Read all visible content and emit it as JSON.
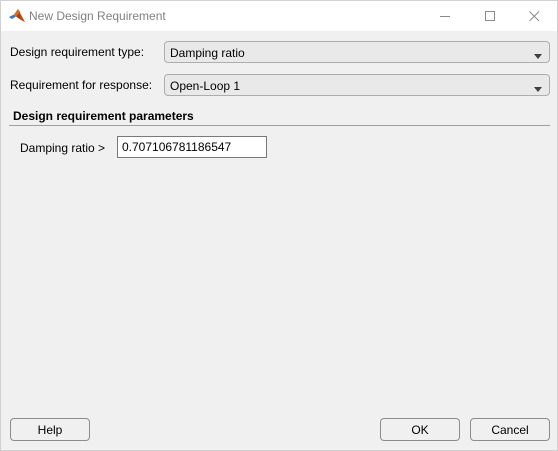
{
  "window": {
    "title": "New Design Requirement",
    "app_icon": "matlab-logo-icon"
  },
  "titlebar_buttons": {
    "minimize_icon": "minimize-icon",
    "maximize_icon": "maximize-icon",
    "close_icon": "close-icon"
  },
  "form": {
    "requirement_type": {
      "label": "Design requirement type:",
      "selected": "Damping ratio",
      "icon": "chevron-down-icon"
    },
    "requirement_response": {
      "label": "Requirement for response:",
      "selected": "Open-Loop 1",
      "icon": "chevron-down-icon"
    }
  },
  "parameters": {
    "section_title": "Design requirement parameters",
    "damping_label": "Damping ratio >",
    "damping_value": "0.707106781186547"
  },
  "footer": {
    "help_label": "Help",
    "ok_label": "OK",
    "cancel_label": "Cancel"
  },
  "colors": {
    "window_bg": "#f0f0f0",
    "titlebar_bg": "#ffffff",
    "combo_bg": "#e9e9e9"
  }
}
